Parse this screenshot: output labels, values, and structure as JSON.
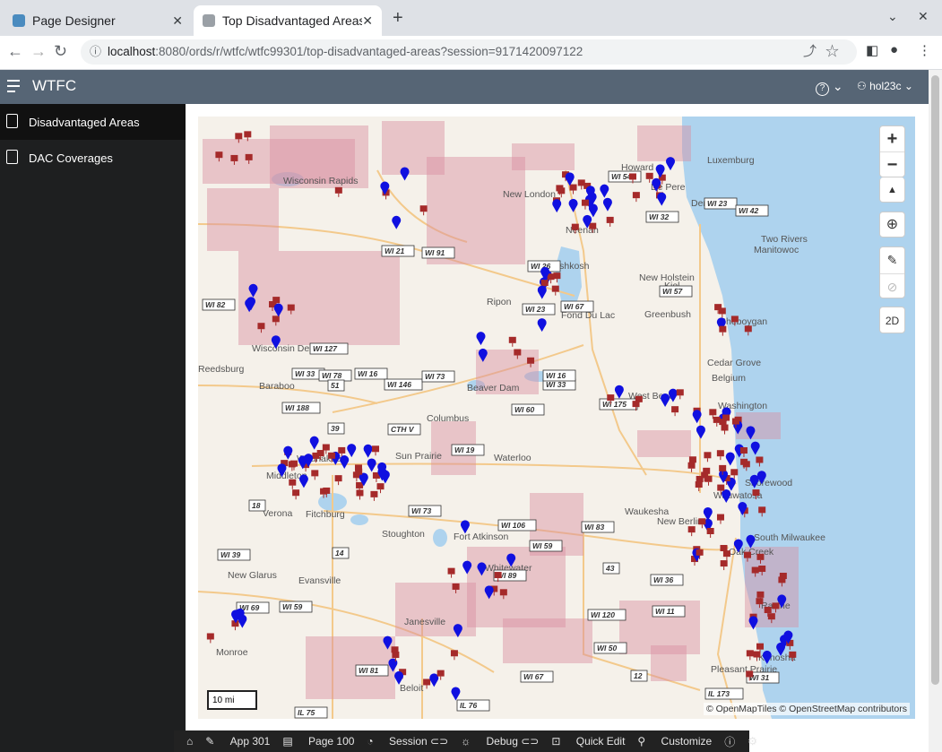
{
  "browser": {
    "tabs": [
      {
        "title": "Page Designer",
        "close": "✕"
      },
      {
        "title": "Top Disadvantaged Areas",
        "close": "✕"
      }
    ],
    "new_tab": "+",
    "url_host": "localhost",
    "url_rest": ":8080/ords/r/wtfc/wtfc99301/top-disadvantaged-areas?session=9171420097122"
  },
  "app": {
    "name": "WTFC",
    "help": "?",
    "user": "hol23c"
  },
  "sidebar": {
    "items": [
      {
        "label": "Disadvantaged Areas"
      },
      {
        "label": "DAC Coverages"
      }
    ]
  },
  "map": {
    "controls": {
      "zoom_in": "+",
      "zoom_out": "−",
      "north": "▲",
      "mode": "2D"
    },
    "scale": "10 mi",
    "attribution": "© OpenMapTiles  © OpenStreetMap contributors",
    "places": [
      {
        "name": "Oshkosh",
        "icon": ""
      },
      {
        "name": "Neenah",
        "icon": ""
      },
      {
        "name": "New London",
        "icon": ""
      },
      {
        "name": "Wisconsin Rapids",
        "icon": ""
      },
      {
        "name": "Ripon",
        "icon": ""
      },
      {
        "name": "Fond Du Lac",
        "icon": ""
      },
      {
        "name": "New Holstein",
        "icon": ""
      },
      {
        "name": "Kiel",
        "icon": ""
      },
      {
        "name": "Greenbush",
        "icon": ""
      },
      {
        "name": "Sheboygan",
        "icon": ""
      },
      {
        "name": "Manitowoc",
        "icon": ""
      },
      {
        "name": "Two Rivers",
        "icon": ""
      },
      {
        "name": "Denmark",
        "icon": ""
      },
      {
        "name": "Luxemburg",
        "icon": ""
      },
      {
        "name": "De Pere",
        "icon": ""
      },
      {
        "name": "Howard",
        "icon": ""
      },
      {
        "name": "Wisconsin Dells",
        "icon": ""
      },
      {
        "name": "Reedsburg",
        "icon": ""
      },
      {
        "name": "Baraboo",
        "icon": ""
      },
      {
        "name": "Beaver Dam",
        "icon": ""
      },
      {
        "name": "Columbus",
        "icon": ""
      },
      {
        "name": "Cedar Grove",
        "icon": ""
      },
      {
        "name": "Belgium",
        "icon": ""
      },
      {
        "name": "West Bend",
        "icon": ""
      },
      {
        "name": "Washington",
        "icon": ""
      },
      {
        "name": "Waunakee",
        "icon": ""
      },
      {
        "name": "Sun Prairie",
        "icon": ""
      },
      {
        "name": "Waterloo",
        "icon": ""
      },
      {
        "name": "Middleton",
        "icon": ""
      },
      {
        "name": "Verona",
        "icon": ""
      },
      {
        "name": "Fitchburg",
        "icon": ""
      },
      {
        "name": "Stoughton",
        "icon": ""
      },
      {
        "name": "Fort Atkinson",
        "icon": ""
      },
      {
        "name": "Whitewater",
        "icon": ""
      },
      {
        "name": "Waukesha",
        "icon": ""
      },
      {
        "name": "New Berlin",
        "icon": ""
      },
      {
        "name": "Shorewood",
        "icon": ""
      },
      {
        "name": "Wauwatosa",
        "icon": ""
      },
      {
        "name": "South Milwaukee",
        "icon": ""
      },
      {
        "name": "Oak Creek",
        "icon": ""
      },
      {
        "name": "Racine",
        "icon": ""
      },
      {
        "name": "Kenosha",
        "icon": ""
      },
      {
        "name": "Pleasant Prairie",
        "icon": ""
      },
      {
        "name": "New Glarus",
        "icon": ""
      },
      {
        "name": "Evansville",
        "icon": ""
      },
      {
        "name": "Janesville",
        "icon": ""
      },
      {
        "name": "Monroe",
        "icon": ""
      },
      {
        "name": "Beloit",
        "icon": ""
      }
    ],
    "shields": [
      "WI 23",
      "WI 21",
      "WI 91",
      "WI 26",
      "WI 23",
      "WI 67",
      "WI 57",
      "WI 42",
      "WI 54",
      "WI 32",
      "WI 82",
      "WI 127",
      "WI 33",
      "WI 78",
      "WI 16",
      "WI 146",
      "WI 73",
      "WI 33",
      "WI 16",
      "WI 60",
      "WI 175",
      "WI 188",
      "CTH V",
      "WI 19",
      "WI 73",
      "WI 106",
      "WI 59",
      "WI 89",
      "WI 83",
      "WI 36",
      "WI 11",
      "WI 120",
      "WI 50",
      "WI 67",
      "WI 31",
      "WI 39",
      "WI 69",
      "WI 59",
      "WI 81",
      "IL 75",
      "IL 76",
      "IL 173",
      "39",
      "51",
      "18",
      "14",
      "43",
      "12"
    ]
  },
  "devbar": {
    "items": [
      "App 301",
      "Page 100",
      "Session",
      "Debug",
      "Quick Edit",
      "Customize"
    ]
  },
  "colors": {
    "header": "#566575",
    "sidebar": "#1e1f20",
    "pin_red": "#a52a2a",
    "pin_blue": "#1010e0",
    "dac_area": "#d98ea0"
  }
}
